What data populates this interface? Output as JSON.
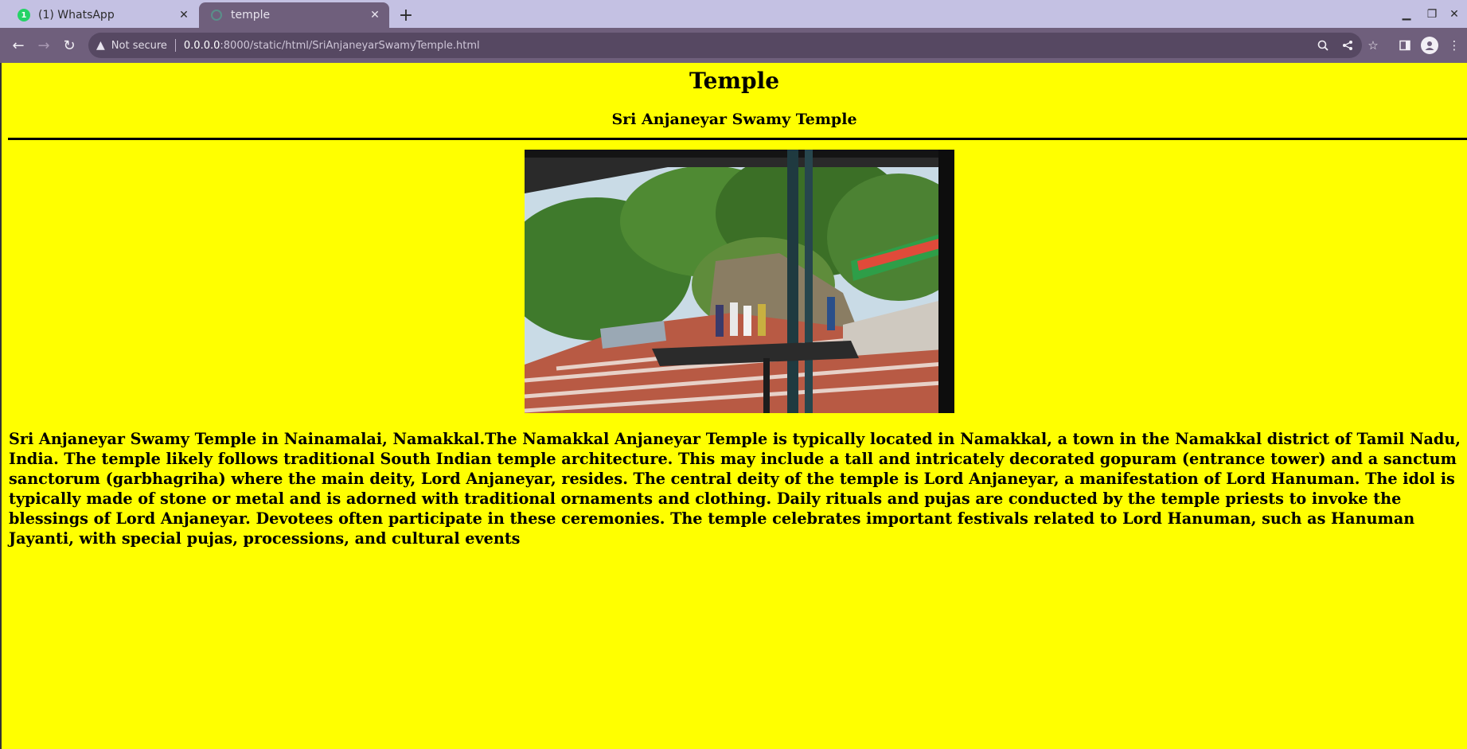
{
  "browser": {
    "tabs": [
      {
        "title": "(1) WhatsApp",
        "badge": "1",
        "active": false
      },
      {
        "title": "temple",
        "active": true
      }
    ],
    "new_tab_icon": "plus-icon",
    "security_label": "Not secure",
    "url_host": "0.0.0.0",
    "url_path": ":8000/static/html/SriAnjaneyarSwamyTemple.html",
    "accent_color": "#6f5f7c",
    "tabstrip_color": "#c4c1e3"
  },
  "page": {
    "background_color": "#ffff00",
    "heading": "Temple",
    "subheading": "Sri Anjaneyar Swamy Temple",
    "image_icon": "temple-steps-photo",
    "description": "Sri Anjaneyar Swamy Temple in Nainamalai, Namakkal.The Namakkal Anjaneyar Temple is typically located in Namakkal, a town in the Namakkal district of Tamil Nadu, India. The temple likely follows traditional South Indian temple architecture. This may include a tall and intricately decorated gopuram (entrance tower) and a sanctum sanctorum (garbhagriha) where the main deity, Lord Anjaneyar, resides. The central deity of the temple is Lord Anjaneyar, a manifestation of Lord Hanuman. The idol is typically made of stone or metal and is adorned with traditional ornaments and clothing. Daily rituals and pujas are conducted by the temple priests to invoke the blessings of Lord Anjaneyar. Devotees often participate in these ceremonies. The temple celebrates important festivals related to Lord Hanuman, such as Hanuman Jayanti, with special pujas, processions, and cultural events"
  }
}
